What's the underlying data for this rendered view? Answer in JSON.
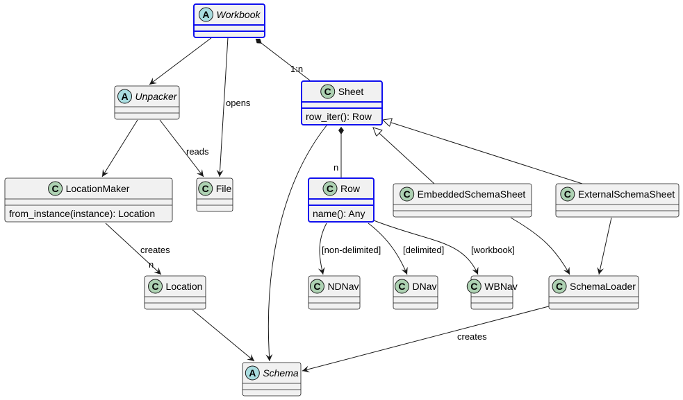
{
  "diagram": {
    "type": "uml-class-diagram",
    "colors": {
      "highlight_border": "#1010ee",
      "class_fill": "#f1f1f1",
      "class_badge": "#add1b2",
      "abstract_badge": "#a9dcdf"
    },
    "classes": [
      {
        "id": "workbook",
        "name": "Workbook",
        "kind": "A",
        "abstract": true,
        "highlighted": true,
        "methods": []
      },
      {
        "id": "unpacker",
        "name": "Unpacker",
        "kind": "A",
        "abstract": true,
        "highlighted": false,
        "methods": []
      },
      {
        "id": "sheet",
        "name": "Sheet",
        "kind": "C",
        "abstract": false,
        "highlighted": true,
        "methods": [
          "row_iter(): Row"
        ]
      },
      {
        "id": "locationmaker",
        "name": "LocationMaker",
        "kind": "C",
        "abstract": false,
        "highlighted": false,
        "methods": [
          "from_instance(instance): Location"
        ]
      },
      {
        "id": "file",
        "name": "File",
        "kind": "C",
        "abstract": false,
        "highlighted": false,
        "methods": []
      },
      {
        "id": "row",
        "name": "Row",
        "kind": "C",
        "abstract": false,
        "highlighted": true,
        "methods": [
          "name(): Any"
        ]
      },
      {
        "id": "embedded",
        "name": "EmbeddedSchemaSheet",
        "kind": "C",
        "abstract": false,
        "highlighted": false,
        "methods": []
      },
      {
        "id": "external",
        "name": "ExternalSchemaSheet",
        "kind": "C",
        "abstract": false,
        "highlighted": false,
        "methods": []
      },
      {
        "id": "location",
        "name": "Location",
        "kind": "C",
        "abstract": false,
        "highlighted": false,
        "methods": []
      },
      {
        "id": "ndnav",
        "name": "NDNav",
        "kind": "C",
        "abstract": false,
        "highlighted": false,
        "methods": []
      },
      {
        "id": "dnav",
        "name": "DNav",
        "kind": "C",
        "abstract": false,
        "highlighted": false,
        "methods": []
      },
      {
        "id": "wbnav",
        "name": "WBNav",
        "kind": "C",
        "abstract": false,
        "highlighted": false,
        "methods": []
      },
      {
        "id": "schemaloader",
        "name": "SchemaLoader",
        "kind": "C",
        "abstract": false,
        "highlighted": false,
        "methods": []
      },
      {
        "id": "schema",
        "name": "Schema",
        "kind": "A",
        "abstract": true,
        "highlighted": false,
        "methods": []
      }
    ],
    "relations": [
      {
        "id": "wb-unpacker",
        "from": "Workbook",
        "to": "Unpacker",
        "type": "association",
        "label": ""
      },
      {
        "id": "wb-file",
        "from": "Workbook",
        "to": "File",
        "type": "association",
        "label": "opens"
      },
      {
        "id": "wb-sheet",
        "from": "Workbook",
        "to": "Sheet",
        "type": "composition",
        "label": "1:n"
      },
      {
        "id": "unpacker-lm",
        "from": "Unpacker",
        "to": "LocationMaker",
        "type": "association",
        "label": ""
      },
      {
        "id": "unpacker-file",
        "from": "Unpacker",
        "to": "File",
        "type": "association",
        "label": "reads"
      },
      {
        "id": "lm-location",
        "from": "LocationMaker",
        "to": "Location",
        "type": "association",
        "label": "creates",
        "multiplicity": "n"
      },
      {
        "id": "location-schema",
        "from": "Location",
        "to": "Schema",
        "type": "association",
        "label": ""
      },
      {
        "id": "sheet-schema",
        "from": "Sheet",
        "to": "Schema",
        "type": "association",
        "label": ""
      },
      {
        "id": "sheet-row",
        "from": "Sheet",
        "to": "Row",
        "type": "composition",
        "label": "n"
      },
      {
        "id": "embedded-sheet",
        "from": "EmbeddedSchemaSheet",
        "to": "Sheet",
        "type": "inheritance",
        "label": ""
      },
      {
        "id": "external-sheet",
        "from": "ExternalSchemaSheet",
        "to": "Sheet",
        "type": "inheritance",
        "label": ""
      },
      {
        "id": "row-ndnav",
        "from": "Row",
        "to": "NDNav",
        "type": "association",
        "label": "[non-delimited]"
      },
      {
        "id": "row-dnav",
        "from": "Row",
        "to": "DNav",
        "type": "association",
        "label": "[delimited]"
      },
      {
        "id": "row-wbnav",
        "from": "Row",
        "to": "WBNav",
        "type": "association",
        "label": "[workbook]"
      },
      {
        "id": "embedded-loader",
        "from": "EmbeddedSchemaSheet",
        "to": "SchemaLoader",
        "type": "association",
        "label": ""
      },
      {
        "id": "external-loader",
        "from": "ExternalSchemaSheet",
        "to": "SchemaLoader",
        "type": "association",
        "label": ""
      },
      {
        "id": "loader-schema",
        "from": "SchemaLoader",
        "to": "Schema",
        "type": "association",
        "label": "creates"
      }
    ]
  }
}
